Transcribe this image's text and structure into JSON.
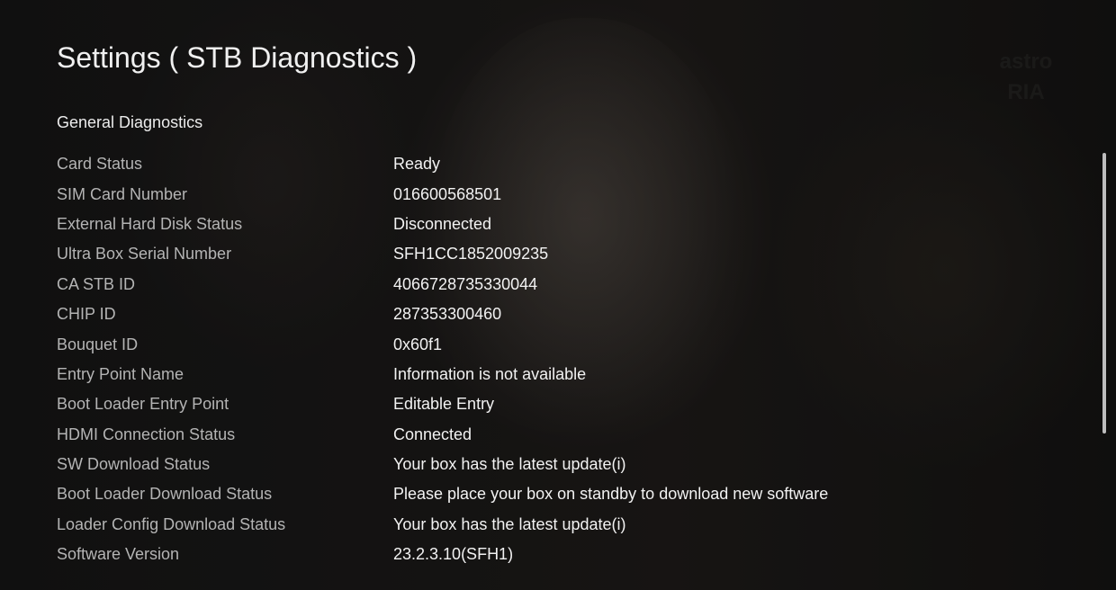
{
  "page": {
    "title": "Settings ( STB Diagnostics )",
    "section_title": "General Diagnostics",
    "watermark": [
      "astro",
      "RIA"
    ]
  },
  "diagnostics": [
    {
      "label": "Card Status",
      "value": "Ready"
    },
    {
      "label": "SIM Card Number",
      "value": "016600568501"
    },
    {
      "label": "External Hard Disk Status",
      "value": "Disconnected"
    },
    {
      "label": "Ultra Box Serial Number",
      "value": "SFH1CC1852009235"
    },
    {
      "label": "CA STB ID",
      "value": "4066728735330044"
    },
    {
      "label": "CHIP ID",
      "value": "287353300460"
    },
    {
      "label": "Bouquet ID",
      "value": "0x60f1"
    },
    {
      "label": "Entry Point Name",
      "value": "Information is not available"
    },
    {
      "label": "Boot Loader Entry Point",
      "value": "Editable Entry"
    },
    {
      "label": "HDMI Connection Status",
      "value": "Connected"
    },
    {
      "label": "SW Download Status",
      "value": "Your box has the latest update(i)"
    },
    {
      "label": "Boot Loader Download Status",
      "value": "Please place your box on standby to download new software"
    },
    {
      "label": "Loader Config Download Status",
      "value": "Your box has the latest update(i)"
    },
    {
      "label": "Software Version",
      "value": "23.2.3.10(SFH1)"
    }
  ],
  "colors": {
    "label": "#b4b4b4",
    "value": "#f2f2f2",
    "title": "#f0f0f0"
  }
}
